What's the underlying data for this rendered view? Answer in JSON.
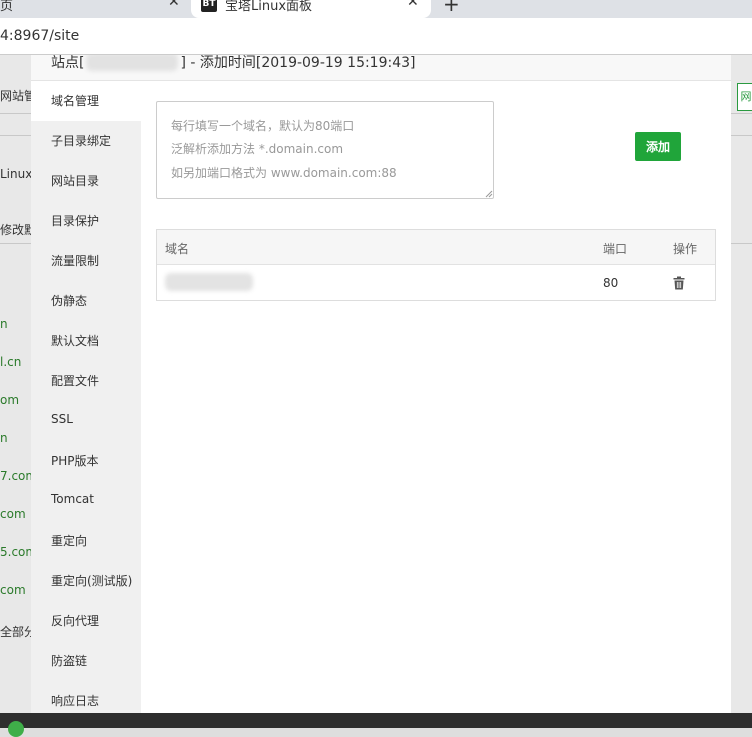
{
  "browser": {
    "tab1_title": "页",
    "tab2_logo": "BT",
    "tab2_title": "宝塔Linux面板",
    "tab_close": "✕",
    "new_tab": "+",
    "url": "4:8967/site"
  },
  "background": {
    "labels": [
      "网站管",
      "Linux",
      "修改默",
      "全部分"
    ],
    "links": [
      "n",
      "l.cn",
      "om",
      "n",
      "7.com",
      "com",
      "5.com",
      "com"
    ],
    "right_button": "网"
  },
  "dialog": {
    "title_prefix": "站点[",
    "title_suffix": "] - 添加时间[2019-09-19 15:19:43]",
    "menu": [
      "域名管理",
      "子目录绑定",
      "网站目录",
      "目录保护",
      "流量限制",
      "伪静态",
      "默认文档",
      "配置文件",
      "SSL",
      "PHP版本",
      "Tomcat",
      "重定向",
      "重定向(测试版)",
      "反向代理",
      "防盗链",
      "响应日志"
    ],
    "active_menu_index": 0,
    "domain_input": {
      "value": "",
      "placeholder_lines": [
        "每行填写一个域名，默认为80端口",
        "泛解析添加方法 *.domain.com",
        "如另加端口格式为 www.domain.com:88"
      ]
    },
    "add_button_label": "添加",
    "table": {
      "headers": {
        "domain": "域名",
        "port": "端口",
        "action": "操作"
      },
      "rows": [
        {
          "domain": "",
          "port": "80",
          "action_icon": "trash-icon"
        }
      ]
    }
  },
  "colors": {
    "accent": "#20a53a",
    "sidebar_bg": "#f0f0f0"
  }
}
